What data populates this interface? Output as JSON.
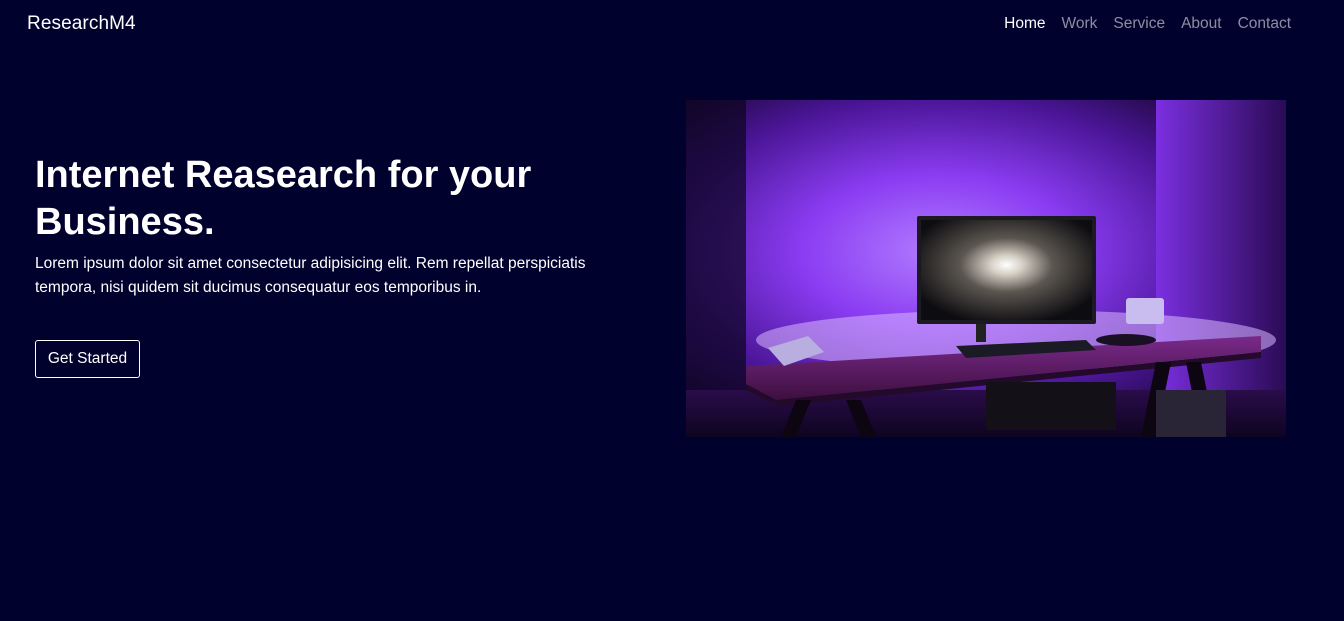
{
  "navbar": {
    "brand": "ResearchM4",
    "links": [
      {
        "label": "Home",
        "active": true
      },
      {
        "label": "Work",
        "active": false
      },
      {
        "label": "Service",
        "active": false
      },
      {
        "label": "About",
        "active": false
      },
      {
        "label": "Contact",
        "active": false
      }
    ]
  },
  "hero": {
    "title": "Internet Reasearch for your Business.",
    "description": "Lorem ipsum dolor sit amet consectetur adipisicing elit. Rem repellat perspiciatis tempora, nisi quidem sit ducimus consequatur eos temporibus in.",
    "cta_label": "Get Started"
  },
  "colors": {
    "background": "#01012d",
    "text": "#ffffff",
    "nav_muted": "rgba(255,255,255,0.55)",
    "glow": "#8a3cff"
  }
}
